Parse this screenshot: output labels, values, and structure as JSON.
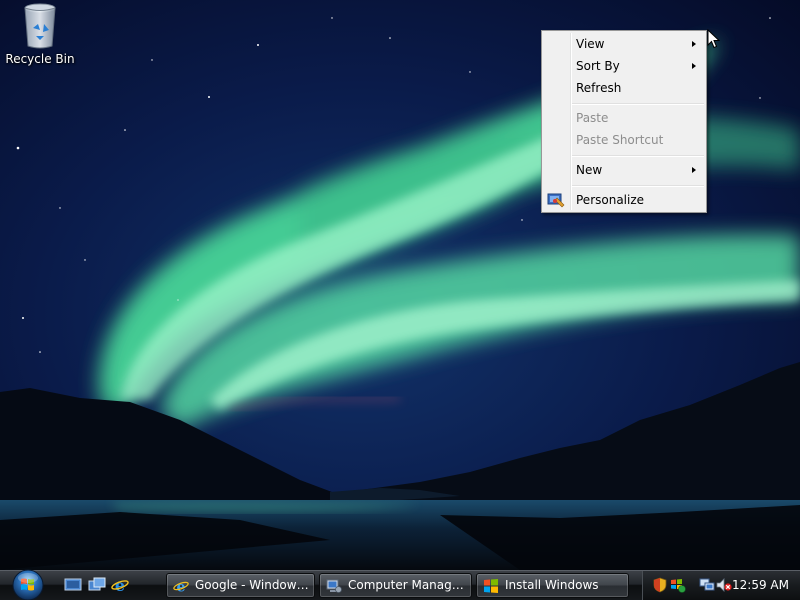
{
  "desktop": {
    "icons": [
      {
        "label": "Recycle Bin",
        "icon": "recycle-bin-icon"
      }
    ]
  },
  "context_menu": {
    "items": [
      {
        "label": "View",
        "submenu": true,
        "disabled": false
      },
      {
        "label": "Sort By",
        "submenu": true,
        "disabled": false
      },
      {
        "label": "Refresh",
        "submenu": false,
        "disabled": false
      },
      {
        "label": "Paste",
        "submenu": false,
        "disabled": true
      },
      {
        "label": "Paste Shortcut",
        "submenu": false,
        "disabled": true
      },
      {
        "label": "New",
        "submenu": true,
        "disabled": false
      },
      {
        "label": "Personalize",
        "submenu": false,
        "disabled": false,
        "icon": "personalize-icon"
      }
    ]
  },
  "taskbar": {
    "start_icon": "windows-start-orb-icon",
    "quick_launch": [
      {
        "icon": "show-desktop-icon"
      },
      {
        "icon": "switch-windows-icon"
      },
      {
        "icon": "internet-explorer-icon"
      }
    ],
    "tasks": [
      {
        "label": "Google - Windows I...",
        "icon": "internet-explorer-icon"
      },
      {
        "label": "Computer Manage...",
        "icon": "computer-management-icon"
      },
      {
        "label": "Install Windows",
        "icon": "windows-logo-icon"
      }
    ],
    "tray": {
      "icons": [
        "security-shield-icon",
        "windows-update-icon",
        "network-icon",
        "volume-muted-icon"
      ],
      "clock": "12:59 AM"
    }
  },
  "colors": {
    "aurora": "#5fe0a6",
    "sky": "#0b1a48",
    "taskbar": "#1e2226",
    "menu_bg": "#f0f0f0"
  }
}
